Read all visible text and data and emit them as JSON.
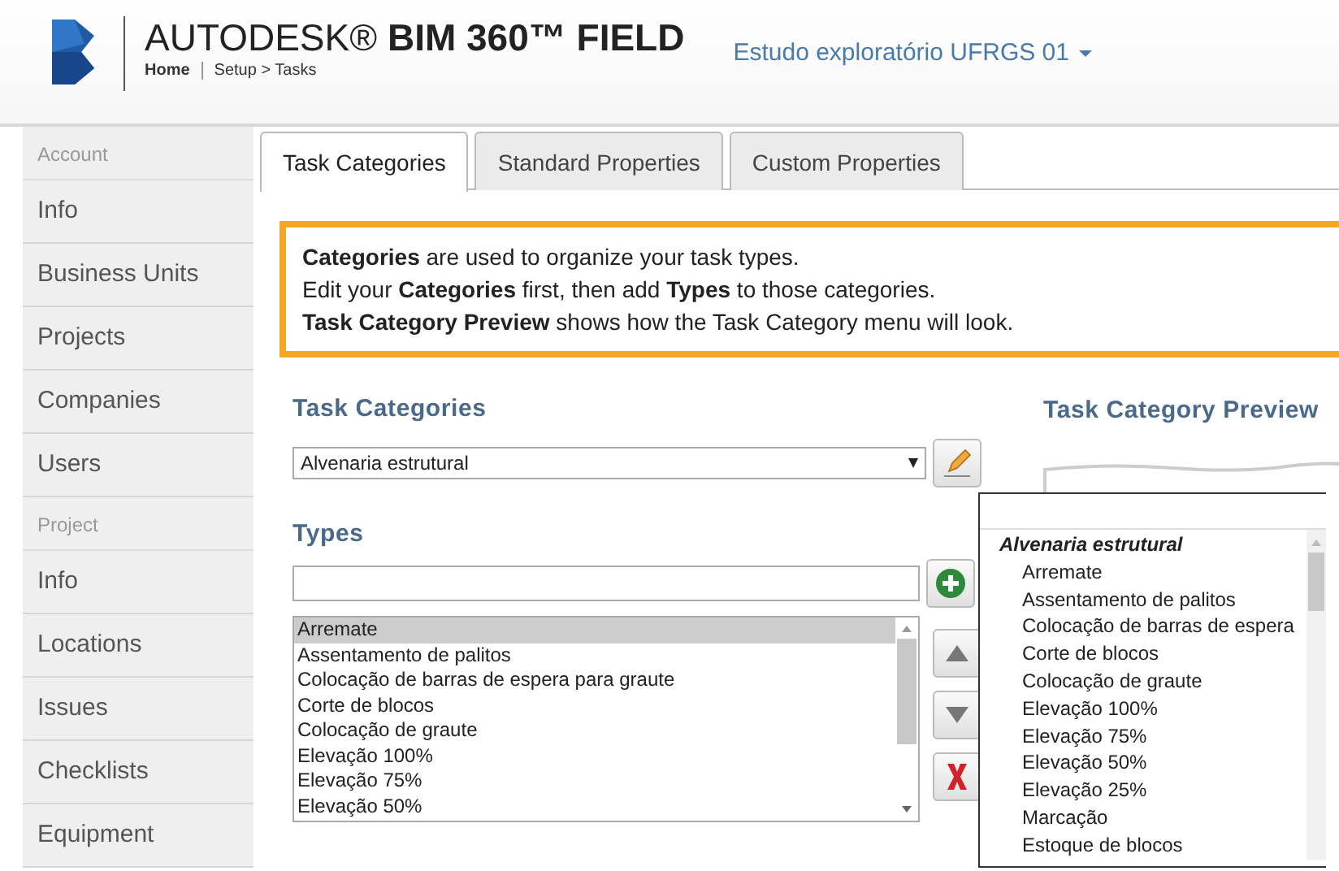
{
  "header": {
    "brand": "AUTODESK® **BIM 360™ FIELD**",
    "breadcrumb": [
      {
        "label": "Home",
        "kind": "link"
      },
      {
        "label": "Setup > Tasks",
        "kind": "text"
      }
    ],
    "project": "Estudo exploratório UFRGS 01"
  },
  "sidebar": [
    {
      "label": "Account",
      "items": [
        {
          "label": "Info"
        },
        {
          "label": "Business Units"
        },
        {
          "label": "Projects"
        },
        {
          "label": "Companies"
        },
        {
          "label": "Users"
        }
      ]
    },
    {
      "label": "Project",
      "items": [
        {
          "label": "Info"
        },
        {
          "label": "Locations"
        },
        {
          "label": "Issues"
        },
        {
          "label": "Checklists"
        },
        {
          "label": "Equipment"
        }
      ]
    }
  ],
  "tabs": [
    {
      "label": "Task Categories",
      "selected": true
    },
    {
      "label": "Standard Properties",
      "selected": false
    },
    {
      "label": "Custom Properties",
      "selected": false
    }
  ],
  "notice": [
    "**Categories** are used to organize your task types.",
    "Edit your **Categories** first, then add **Types** to those categories.",
    "**Task Category Preview** shows how the Task Category menu will look."
  ],
  "task_categories": {
    "heading": "Task Categories",
    "value": "Alvenaria estrutural"
  },
  "types": {
    "heading": "Types",
    "items": [
      {
        "label": "Arremate",
        "selected": true
      },
      {
        "label": "Assentamento de palitos",
        "selected": false
      },
      {
        "label": "Colocação de barras de espera para graute",
        "selected": false
      },
      {
        "label": "Corte de blocos",
        "selected": false
      },
      {
        "label": "Colocação de graute",
        "selected": false
      },
      {
        "label": "Elevação 100%",
        "selected": false
      },
      {
        "label": "Elevação 75%",
        "selected": false
      },
      {
        "label": "Elevação 50%",
        "selected": false
      }
    ]
  },
  "preview": {
    "heading": "Task Category Preview",
    "group": "Alvenaria estrutural",
    "items": [
      "Arremate",
      "Assentamento de palitos",
      "Colocação de barras de espera",
      "Corte de blocos",
      "Colocação de graute",
      "Elevação 100%",
      "Elevação 75%",
      "Elevação 50%",
      "Elevação 25%",
      "Marcação",
      "Estoque de blocos"
    ]
  }
}
